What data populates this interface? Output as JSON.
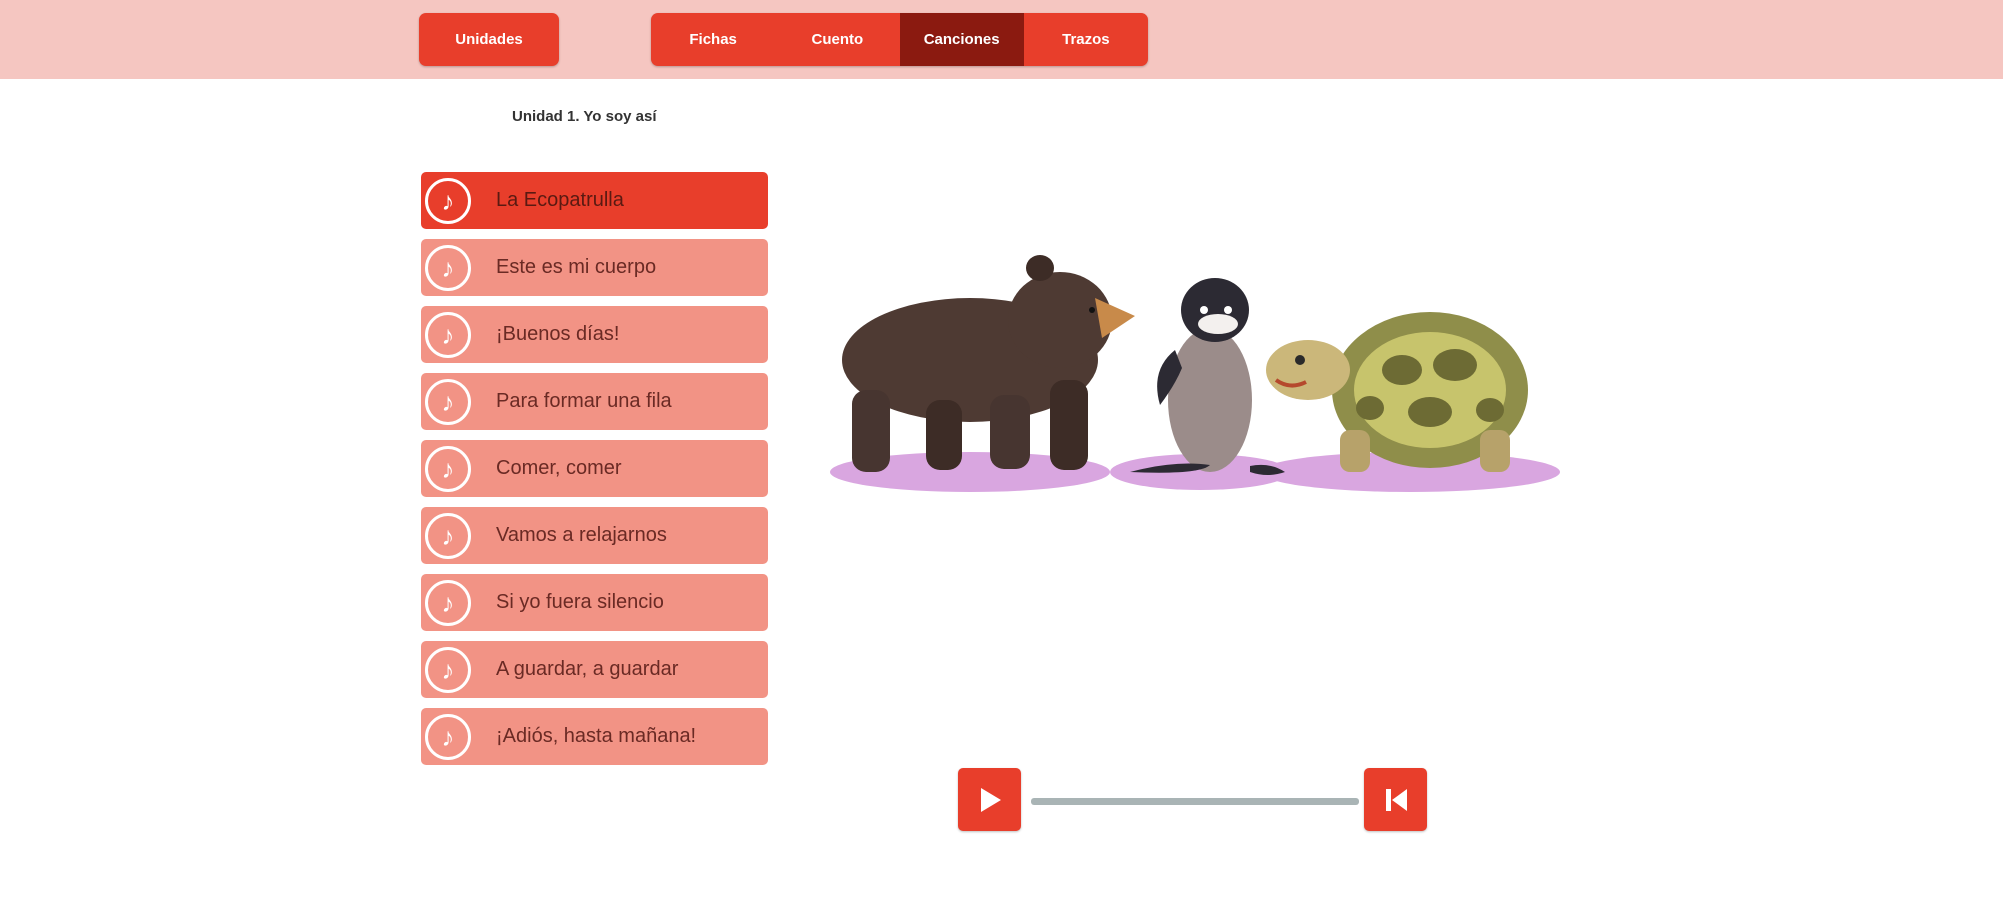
{
  "header": {
    "units_label": "Unidades",
    "tabs": [
      {
        "label": "Fichas",
        "active": false
      },
      {
        "label": "Cuento",
        "active": false
      },
      {
        "label": "Canciones",
        "active": true
      },
      {
        "label": "Trazos",
        "active": false
      }
    ]
  },
  "unit_title": "Unidad 1. Yo soy así",
  "songs": [
    {
      "label": "La Ecopatrulla",
      "active": true
    },
    {
      "label": "Este es mi cuerpo",
      "active": false
    },
    {
      "label": "¡Buenos días!",
      "active": false
    },
    {
      "label": "Para formar una fila",
      "active": false
    },
    {
      "label": "Comer, comer",
      "active": false
    },
    {
      "label": "Vamos a relajarnos",
      "active": false
    },
    {
      "label": "Si yo fuera silencio",
      "active": false
    },
    {
      "label": "A guardar, a guardar",
      "active": false
    },
    {
      "label": "¡Adiós, hasta mañana!",
      "active": false
    }
  ],
  "icons": {
    "song": "music-note-icon",
    "play": "play-icon",
    "restart": "skip-back-icon"
  },
  "colors": {
    "topbar": "#f5c6c1",
    "accent": "#e83e2b",
    "active_tab": "#8b1a10",
    "song_item": "#f29385",
    "track": "#a9b4b5"
  },
  "player": {
    "progress": 0
  }
}
